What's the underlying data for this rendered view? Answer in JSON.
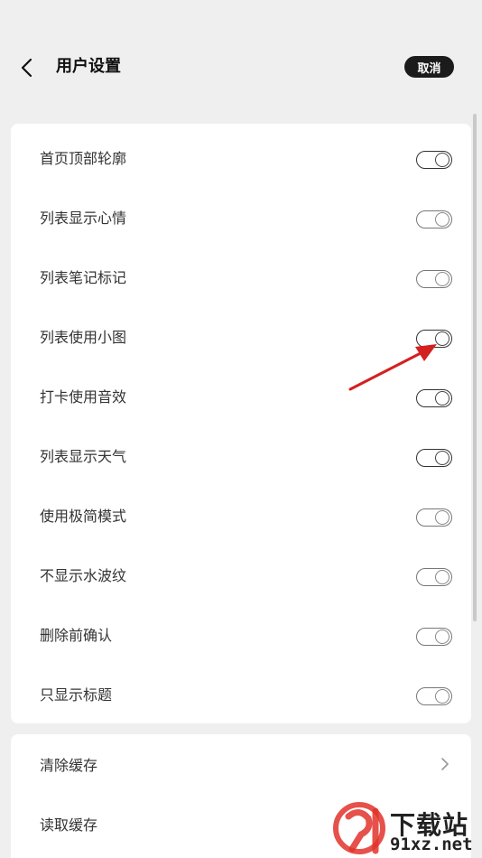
{
  "header": {
    "title": "用户设置",
    "cancel_label": "取消"
  },
  "settings": [
    {
      "label": "首页顶部轮廓",
      "on": true
    },
    {
      "label": "列表显示心情",
      "on": false
    },
    {
      "label": "列表笔记标记",
      "on": false
    },
    {
      "label": "列表使用小图",
      "on": true
    },
    {
      "label": "打卡使用音效",
      "on": true
    },
    {
      "label": "列表显示天气",
      "on": true
    },
    {
      "label": "使用极简模式",
      "on": false
    },
    {
      "label": "不显示水波纹",
      "on": false
    },
    {
      "label": "删除前确认",
      "on": false
    },
    {
      "label": "只显示标题",
      "on": false
    }
  ],
  "cache": {
    "clear_label": "清除缓存",
    "read_label": "读取缓存"
  },
  "watermark": {
    "text": "下载站",
    "url": "91xz.net"
  },
  "colors": {
    "background": "#efefef",
    "card": "#ffffff",
    "button": "#1b1b1b",
    "annotation_arrow": "#d42020"
  }
}
